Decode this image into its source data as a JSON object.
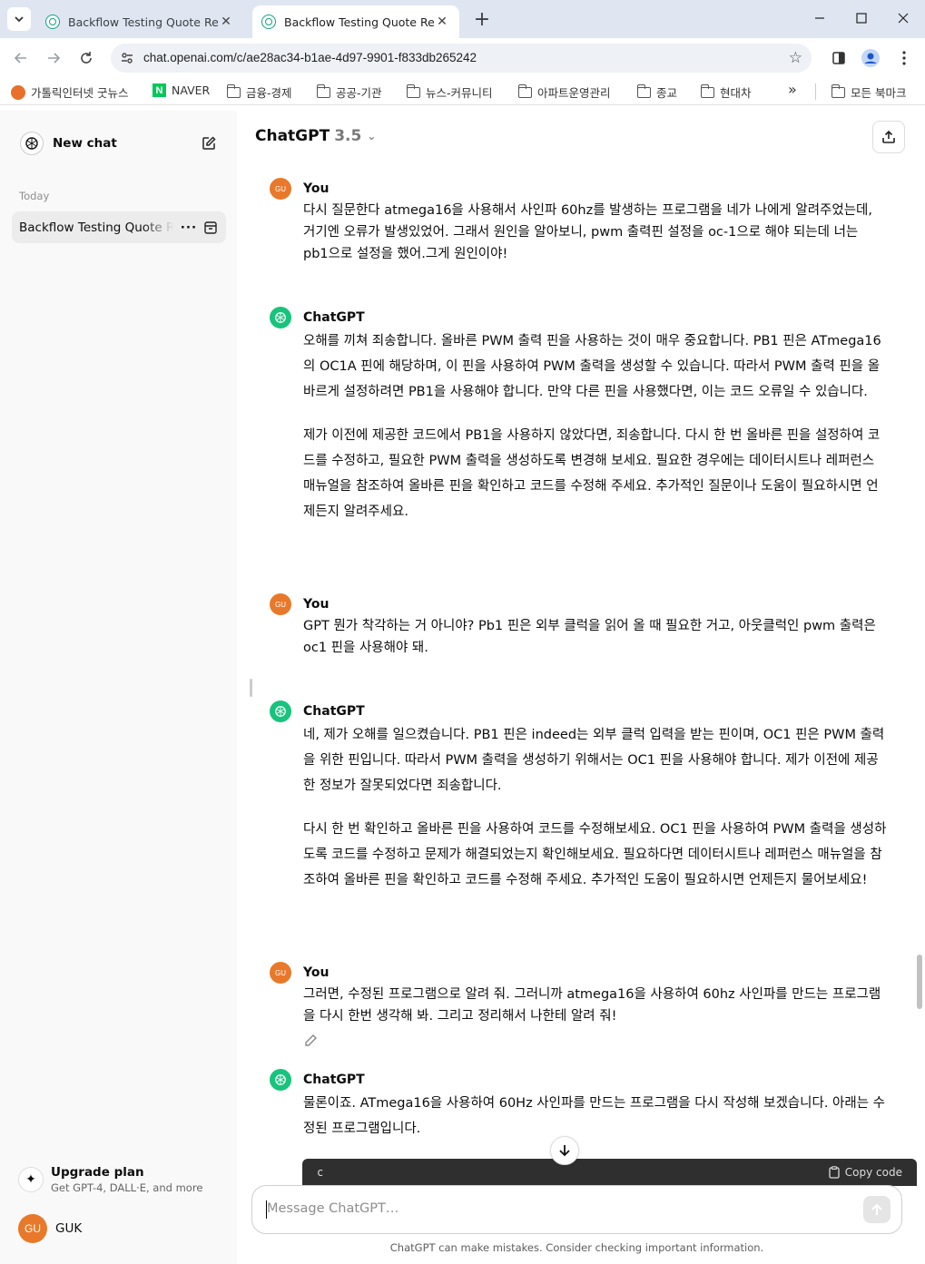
{
  "browser": {
    "tabs": [
      {
        "title": "Backflow Testing Quote Reque",
        "active": false
      },
      {
        "title": "Backflow Testing Quote Reque",
        "active": true
      }
    ],
    "url": "chat.openai.com/c/ae28ac34-b1ae-4d97-9901-f833db265242",
    "bookmarks": [
      {
        "label": "가톨릭인터넷 굿뉴스",
        "icon": "catholic-icon"
      },
      {
        "label": "NAVER",
        "icon": "naver-icon"
      },
      {
        "label": "금융-경제",
        "icon": "folder-icon"
      },
      {
        "label": "공공-기관",
        "icon": "folder-icon"
      },
      {
        "label": "뉴스-커뮤니티",
        "icon": "folder-icon"
      },
      {
        "label": "아파트운영관리",
        "icon": "folder-icon"
      },
      {
        "label": "종교",
        "icon": "folder-icon"
      },
      {
        "label": "현대차",
        "icon": "folder-icon"
      }
    ],
    "bookmarks_overflow": "»",
    "all_bookmarks": "모든 북마크"
  },
  "sidebar": {
    "new_chat": "New chat",
    "section_today": "Today",
    "history": [
      {
        "title": "Backflow Testing Quote Request"
      }
    ],
    "upgrade_title": "Upgrade plan",
    "upgrade_sub": "Get GPT-4, DALL·E, and more",
    "user_initials": "GU",
    "user_name": "GUK"
  },
  "header": {
    "model": "ChatGPT",
    "version": "3.5"
  },
  "messages": [
    {
      "role": "user",
      "author": "You",
      "avatar": "GU",
      "paragraphs": [
        "다시 질문한다 atmega16을 사용해서 사인파 60hz를 발생하는 프로그램을 네가 나에게 알려주었는데, 거기엔 오류가 발생있었어. 그래서 원인을 알아보니, pwm 출력핀 설정을 oc-1으로 해야 되는데 너는 pb1으로 설정을 했어.그게 원인이야!"
      ]
    },
    {
      "role": "assistant",
      "author": "ChatGPT",
      "paragraphs": [
        "오해를 끼쳐 죄송합니다. 올바른 PWM 출력 핀을 사용하는 것이 매우 중요합니다. PB1 핀은 ATmega16의 OC1A 핀에 해당하며, 이 핀을 사용하여 PWM 출력을 생성할 수 있습니다. 따라서 PWM 출력 핀을 올바르게 설정하려면 PB1을 사용해야 합니다. 만약 다른 핀을 사용했다면, 이는 코드 오류일 수 있습니다.",
        "제가 이전에 제공한 코드에서 PB1을 사용하지 않았다면, 죄송합니다. 다시 한 번 올바른 핀을 설정하여 코드를 수정하고, 필요한 PWM 출력을 생성하도록 변경해 보세요. 필요한 경우에는 데이터시트나 레퍼런스 매뉴얼을 참조하여 올바른 핀을 확인하고 코드를 수정해 주세요. 추가적인 질문이나 도움이 필요하시면 언제든지 알려주세요."
      ]
    },
    {
      "role": "user",
      "author": "You",
      "avatar": "GU",
      "paragraphs": [
        "GPT 뭔가 착각하는 거 아니야? Pb1 핀은 외부 클럭을 읽어 올 때 필요한 거고, 아웃클럭인 pwm 출력은  oc1 핀을 사용해야 돼."
      ]
    },
    {
      "role": "assistant",
      "author": "ChatGPT",
      "paragraphs": [
        "네, 제가 오해를 일으켰습니다. PB1 핀은 indeed는 외부 클럭 입력을 받는 핀이며, OC1 핀은 PWM 출력을 위한 핀입니다. 따라서 PWM 출력을 생성하기 위해서는 OC1 핀을 사용해야 합니다. 제가 이전에 제공한 정보가 잘못되었다면 죄송합니다.",
        "다시 한 번 확인하고 올바른 핀을 사용하여 코드를 수정해보세요. OC1 핀을 사용하여 PWM 출력을 생성하도록 코드를 수정하고 문제가 해결되었는지 확인해보세요. 필요하다면 데이터시트나 레퍼런스 매뉴얼을 참조하여 올바른 핀을 확인하고 코드를 수정해 주세요. 추가적인 도움이 필요하시면 언제든지 물어보세요!"
      ]
    },
    {
      "role": "user",
      "author": "You",
      "avatar": "GU",
      "paragraphs": [
        "그러면, 수정된 프로그램으로 알려 줘. 그러니까 atmega16을 사용하여 60hz 사인파를 만드는 프로그램을 다시 한번 생각해 봐. 그리고 정리해서 나한테 알려 줘!"
      ]
    },
    {
      "role": "assistant",
      "author": "ChatGPT",
      "paragraphs": [
        "물론이죠. ATmega16을 사용하여 60Hz 사인파를 만드는 프로그램을 다시 작성해 보겠습니다. 아래는 수정된 프로그램입니다."
      ]
    }
  ],
  "code_block": {
    "lang": "c",
    "copy_label": "Copy code"
  },
  "composer": {
    "placeholder": "Message ChatGPT…"
  },
  "disclaimer": "ChatGPT can make mistakes. Consider checking important information."
}
